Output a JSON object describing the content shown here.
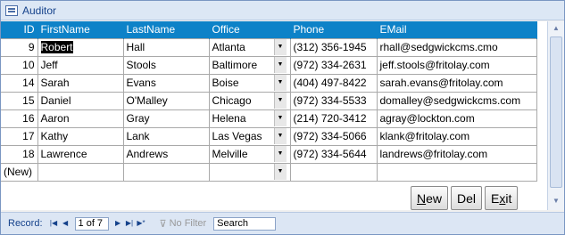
{
  "window": {
    "title": "Auditor"
  },
  "columns": [
    "ID",
    "FirstName",
    "LastName",
    "Office",
    "Phone",
    "EMail"
  ],
  "rows": [
    {
      "id": "9",
      "first": "Robert",
      "last": "Hall",
      "office": "Atlanta",
      "phone": "(312) 356-1945",
      "email": "rhall@sedgwickcms.cmo"
    },
    {
      "id": "10",
      "first": "Jeff",
      "last": "Stools",
      "office": "Baltimore",
      "phone": "(972) 334-2631",
      "email": "jeff.stools@fritolay.com"
    },
    {
      "id": "14",
      "first": "Sarah",
      "last": "Evans",
      "office": "Boise",
      "phone": "(404) 497-8422",
      "email": "sarah.evans@fritolay.com"
    },
    {
      "id": "15",
      "first": "Daniel",
      "last": "O'Malley",
      "office": "Chicago",
      "phone": "(972) 334-5533",
      "email": "domalley@sedgwickcms.com"
    },
    {
      "id": "16",
      "first": "Aaron",
      "last": "Gray",
      "office": "Helena",
      "phone": "(214) 720-3412",
      "email": "agray@lockton.com"
    },
    {
      "id": "17",
      "first": "Kathy",
      "last": "Lank",
      "office": "Las Vegas",
      "phone": "(972) 334-5066",
      "email": "klank@fritolay.com"
    },
    {
      "id": "18",
      "first": "Lawrence",
      "last": "Andrews",
      "office": "Melville",
      "phone": "(972) 334-5644",
      "email": "landrews@fritolay.com"
    }
  ],
  "new_row": {
    "id": "(New)"
  },
  "buttons": {
    "new": {
      "u": "N",
      "rest": "ew"
    },
    "del": {
      "u": "",
      "rest": "Del"
    },
    "exit": {
      "u": "x",
      "pre": "E",
      "rest": "it"
    }
  },
  "navigation": {
    "record_label": "Record:",
    "current": "1 of 7",
    "filter_label": "No Filter",
    "search_label": "Search"
  },
  "colors": {
    "header": "#0d82c8",
    "nav": "#dce6f4"
  }
}
